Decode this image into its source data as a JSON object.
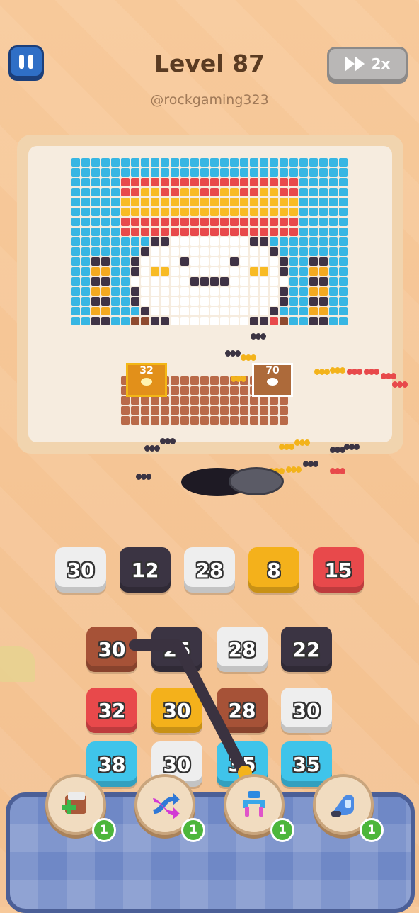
{
  "header": {
    "level_title": "Level 87",
    "handle": "@rockgaming323",
    "speed_label": "2x"
  },
  "colors": {
    "cyan": "#37b6e3",
    "yellow": "#f8bb24",
    "red": "#e8494b",
    "navy": "#3f3346",
    "white": "#ffffff",
    "brown": "#8f4a2f",
    "brick": "#b96a49",
    "gold": "#f3a920"
  },
  "crates": [
    {
      "count": "32",
      "color": "yellow"
    },
    {
      "count": "70",
      "color": "white"
    }
  ],
  "queue": [
    {
      "value": "30",
      "color": "#eeeeee"
    },
    {
      "value": "12",
      "color": "#3b3443"
    },
    {
      "value": "28",
      "color": "#eeeeee"
    },
    {
      "value": "8",
      "color": "#f4b11b"
    },
    {
      "value": "15",
      "color": "#e8494b"
    }
  ],
  "grid": [
    [
      {
        "value": "30",
        "color": "#a65237"
      },
      {
        "value": "25",
        "color": "#3b3443"
      },
      {
        "value": "28",
        "color": "#eeeeee"
      },
      {
        "value": "22",
        "color": "#3b3443"
      }
    ],
    [
      {
        "value": "32",
        "color": "#e8494b"
      },
      {
        "value": "30",
        "color": "#f4b11b"
      },
      {
        "value": "28",
        "color": "#a65237"
      },
      {
        "value": "30",
        "color": "#eeeeee"
      }
    ],
    [
      {
        "value": "38",
        "color": "#3fc4ea"
      },
      {
        "value": "30",
        "color": "#eeeeee"
      },
      {
        "value": "35",
        "color": "#3fc4ea"
      },
      {
        "value": "35",
        "color": "#3fc4ea"
      }
    ]
  ],
  "boosters": [
    {
      "name": "add-box-icon",
      "count": "1"
    },
    {
      "name": "shuffle-icon",
      "count": "1"
    },
    {
      "name": "magnet-claw-icon",
      "count": "1"
    },
    {
      "name": "vacuum-icon",
      "count": "1"
    }
  ]
}
